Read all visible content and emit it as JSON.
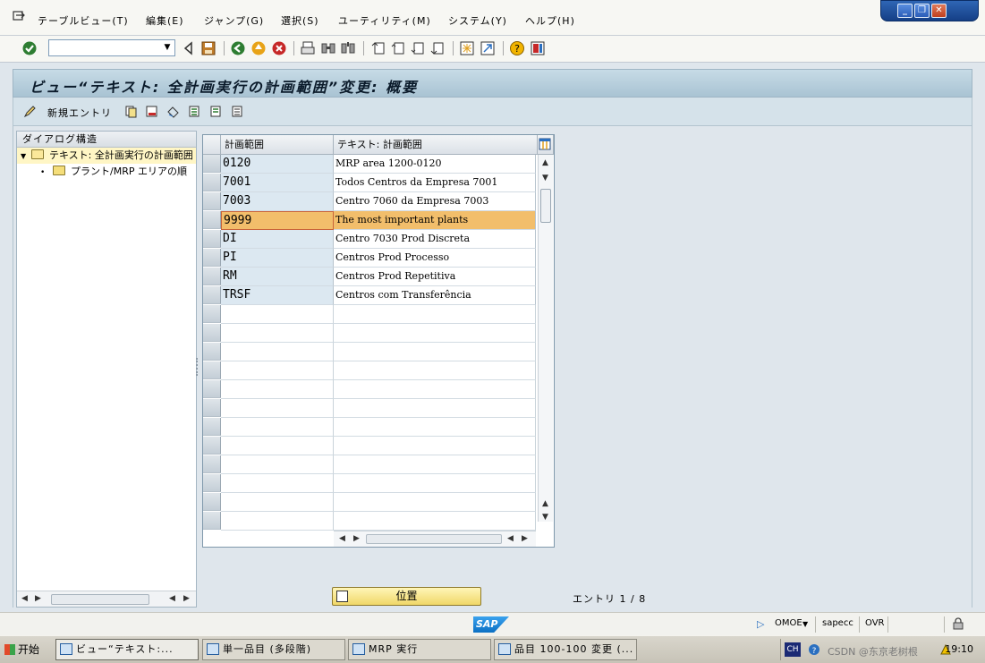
{
  "menubar": {
    "items": [
      "テーブルビュー(T)",
      "編集(E)",
      "ジャンプ(G)",
      "選択(S)",
      "ユーティリティ(M)",
      "システム(Y)",
      "ヘルプ(H)"
    ]
  },
  "toolbar": {
    "command_field_value": ""
  },
  "title": "ビュー“テキスト: 全計画実行の計画範囲”変更: 概要",
  "app_toolbar": {
    "new_entries_label": "新規エントリ"
  },
  "dialog_structure": {
    "header": "ダイアログ構造",
    "items": [
      {
        "label": "テキスト: 全計画実行の計画範囲",
        "level": 0,
        "selected": true,
        "expanded": true
      },
      {
        "label": "プラント/MRP エリアの順",
        "level": 1,
        "selected": false,
        "expanded": false
      }
    ]
  },
  "table": {
    "columns": [
      "計画範囲",
      "テキスト: 計画範囲"
    ],
    "rows": [
      {
        "key": "0120",
        "text": "MRP area 1200-0120"
      },
      {
        "key": "7001",
        "text": "Todos Centros da Empresa 7001"
      },
      {
        "key": "7003",
        "text": "Centro 7060 da Empresa 7003"
      },
      {
        "key": "9999",
        "text": "The most important plants"
      },
      {
        "key": "DI",
        "text": "Centro 7030 Prod Discreta"
      },
      {
        "key": "PI",
        "text": "Centros Prod Processo"
      },
      {
        "key": "RM",
        "text": "Centros Prod Repetitiva"
      },
      {
        "key": "TRSF",
        "text": "Centros com Transferência"
      }
    ],
    "highlighted_row": 3,
    "empty_rows": 12
  },
  "position_button_label": "位置",
  "entry_count": "エントリ 1 / 8",
  "status": {
    "logo": "SAP",
    "system": "OMOE",
    "server": "sapecc",
    "mode": "OVR"
  },
  "taskbar": {
    "start_label": "开始",
    "items": [
      {
        "label": "ビュー“テキスト:...",
        "active": true
      },
      {
        "label": "単一品目 (多段階)",
        "active": false
      },
      {
        "label": "MRP 実行",
        "active": false
      },
      {
        "label": "品目 100-100 変更 (...",
        "active": false
      }
    ],
    "ime": "CH",
    "watermark": "CSDN @东京老树根",
    "clock": "19:10"
  },
  "colors": {
    "highlight": "#f2be6b",
    "key_cell": "#dce8f1",
    "title_bg": "#a9c3d3"
  }
}
